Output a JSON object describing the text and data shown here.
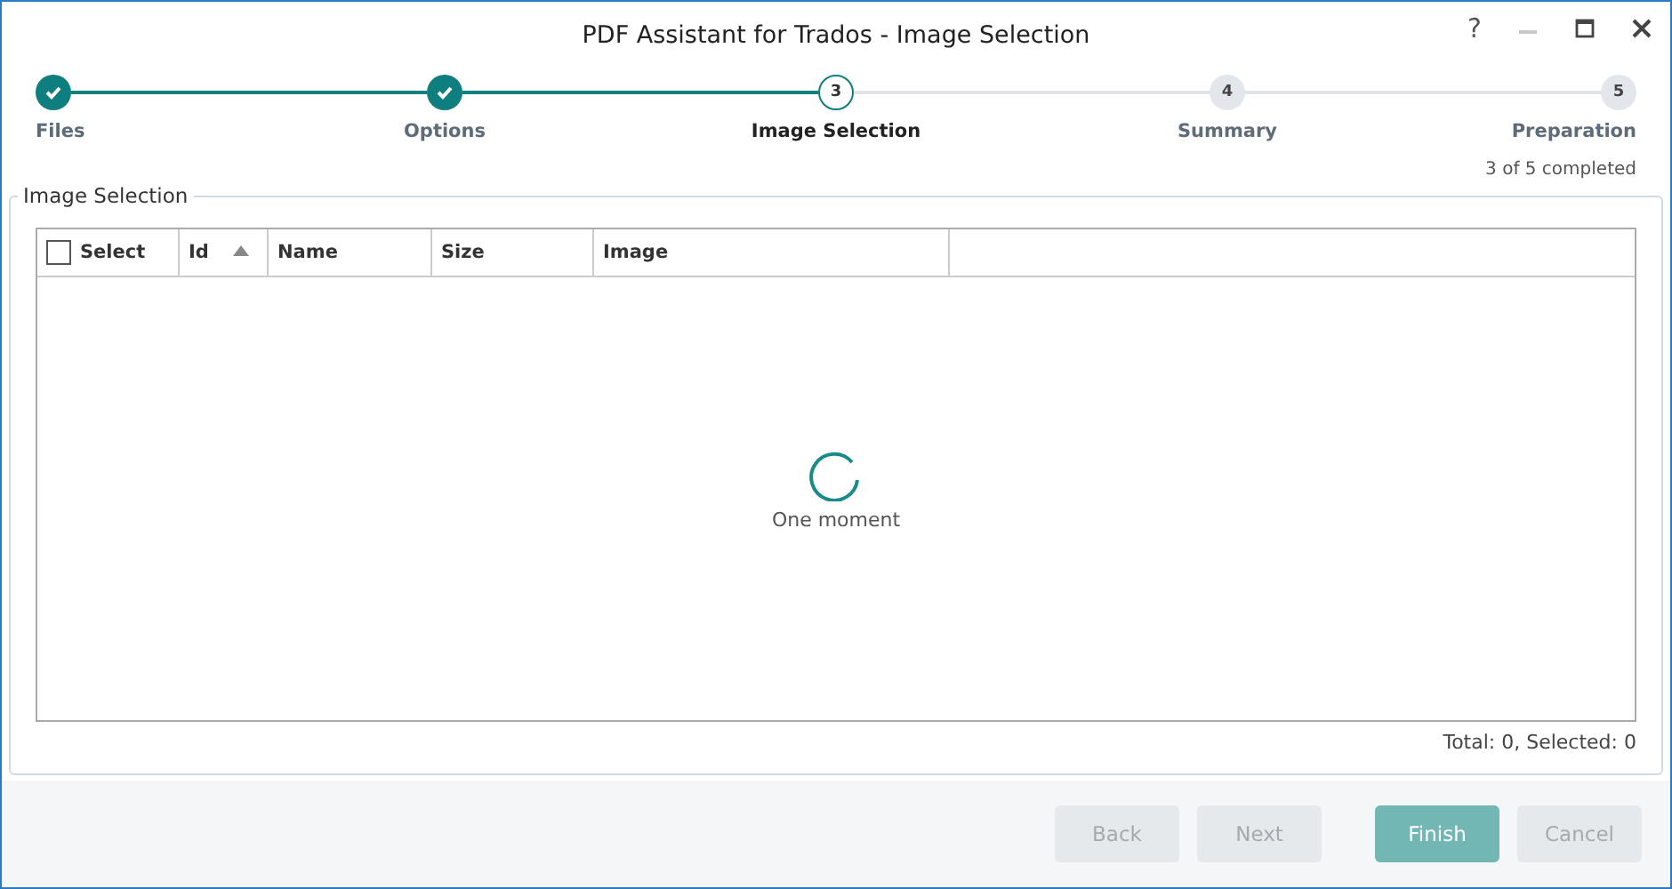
{
  "window": {
    "title": "PDF Assistant for Trados - Image Selection",
    "help": "?"
  },
  "steps": [
    {
      "label": "Files",
      "completed": true,
      "selected": false
    },
    {
      "label": "Options",
      "completed": true,
      "selected": false
    },
    {
      "label": "Image Selection",
      "number": "3",
      "completed": false,
      "selected": true
    },
    {
      "label": "Summary",
      "number": "4",
      "completed": false,
      "selected": false
    },
    {
      "label": "Preparation",
      "number": "5",
      "completed": false,
      "selected": false
    }
  ],
  "progress_text": "3 of 5 completed",
  "group": {
    "title": "Image Selection"
  },
  "table": {
    "select_all": {
      "label": "Select",
      "checked": false
    },
    "columns": [
      {
        "label": "Id",
        "sorted": true
      },
      {
        "label": "Name",
        "sorted": false
      },
      {
        "label": "Size",
        "sorted": false
      },
      {
        "label": "Image",
        "sorted": false
      }
    ],
    "loading": "One moment"
  },
  "summary": "Total: 0, Selected: 0",
  "buttons": [
    {
      "label": "Back",
      "kind": "default",
      "disabled": true
    },
    {
      "label": "Next",
      "kind": "default",
      "disabled": true
    },
    {
      "label": "Finish",
      "kind": "primary",
      "disabled": false
    },
    {
      "label": "Cancel",
      "kind": "default",
      "disabled": true
    }
  ]
}
